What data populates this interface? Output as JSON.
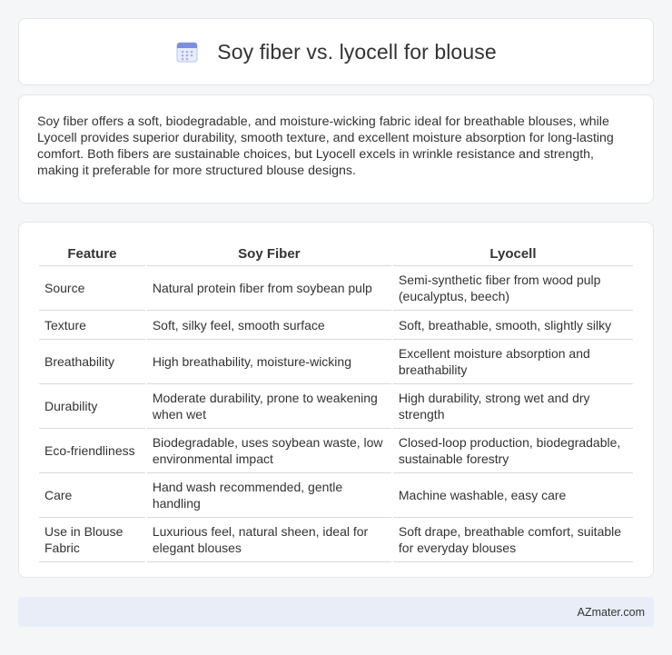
{
  "header": {
    "icon": "calendar-icon",
    "title": "Soy fiber vs. lyocell for blouse"
  },
  "summary": {
    "text": "Soy fiber offers a soft, biodegradable, and moisture-wicking fabric ideal for breathable blouses, while Lyocell provides superior durability, smooth texture, and excellent moisture absorption for long-lasting comfort. Both fibers are sustainable choices, but Lyocell excels in wrinkle resistance and strength, making it preferable for more structured blouse designs."
  },
  "table": {
    "headers": [
      "Feature",
      "Soy Fiber",
      "Lyocell"
    ],
    "rows": [
      [
        "Source",
        "Natural protein fiber from soybean pulp",
        "Semi-synthetic fiber from wood pulp (eucalyptus, beech)"
      ],
      [
        "Texture",
        "Soft, silky feel, smooth surface",
        "Soft, breathable, smooth, slightly silky"
      ],
      [
        "Breathability",
        "High breathability, moisture-wicking",
        "Excellent moisture absorption and breathability"
      ],
      [
        "Durability",
        "Moderate durability, prone to weakening when wet",
        "High durability, strong wet and dry strength"
      ],
      [
        "Eco-friendliness",
        "Biodegradable, uses soybean waste, low environmental impact",
        "Closed-loop production, biodegradable, sustainable forestry"
      ],
      [
        "Care",
        "Hand wash recommended, gentle handling",
        "Machine washable, easy care"
      ],
      [
        "Use in Blouse Fabric",
        "Luxurious feel, natural sheen, ideal for elegant blouses",
        "Soft drape, breathable comfort, suitable for everyday blouses"
      ]
    ]
  },
  "footer": {
    "brand": "AZmater.com"
  },
  "colors": {
    "background": "#f5f6f8",
    "card": "#ffffff",
    "footer": "#e8edf7",
    "icon_accent": "#7b8ee0"
  }
}
